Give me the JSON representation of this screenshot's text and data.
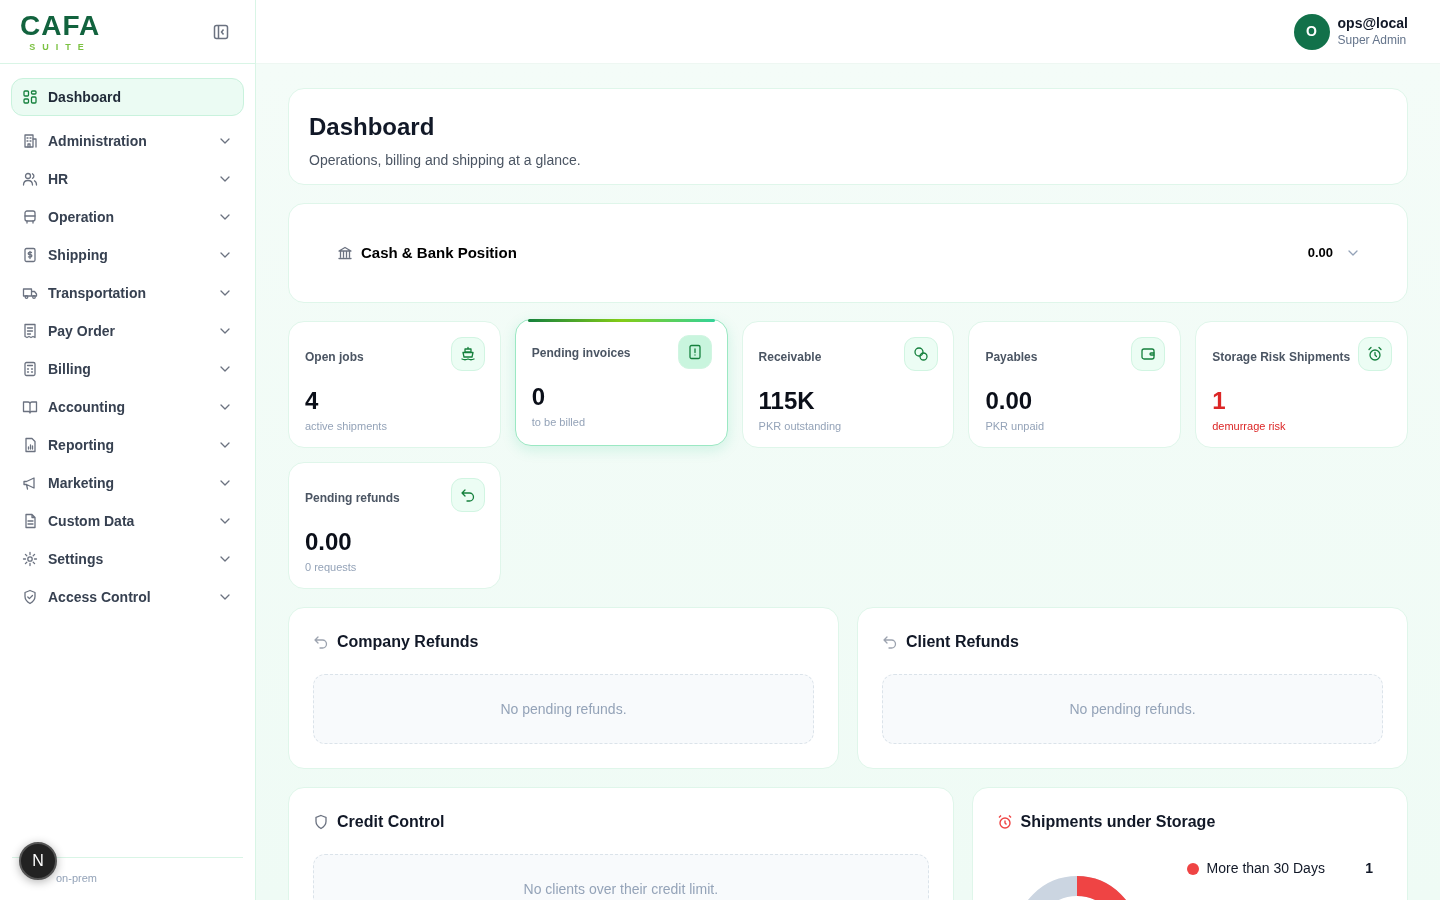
{
  "brand": {
    "logo_text": "CAFA",
    "logo_sub": "SUITE"
  },
  "user": {
    "initial": "O",
    "email": "ops@local",
    "role": "Super Admin"
  },
  "sidebar": {
    "items": [
      {
        "label": "Dashboard",
        "selected": true
      },
      {
        "label": "Administration",
        "selected": false,
        "expanded": false
      },
      {
        "label": "HR",
        "selected": false,
        "expanded": false
      },
      {
        "label": "Operation",
        "selected": false,
        "expanded": false
      },
      {
        "label": "Shipping",
        "selected": false,
        "expanded": false
      },
      {
        "label": "Transportation",
        "selected": false,
        "expanded": false
      },
      {
        "label": "Pay Order",
        "selected": false,
        "expanded": false
      },
      {
        "label": "Billing",
        "selected": false,
        "expanded": false
      },
      {
        "label": "Accounting",
        "selected": false,
        "expanded": false
      },
      {
        "label": "Reporting",
        "selected": false,
        "expanded": false
      },
      {
        "label": "Marketing",
        "selected": false,
        "expanded": false
      },
      {
        "label": "Custom Data",
        "selected": false,
        "expanded": false
      },
      {
        "label": "Settings",
        "selected": false,
        "expanded": false
      },
      {
        "label": "Access Control",
        "selected": false,
        "expanded": false
      }
    ],
    "footer": "on-prem",
    "dev_badge": "N"
  },
  "page": {
    "title": "Dashboard",
    "subtitle": "Operations, billing and shipping at a glance."
  },
  "cash_bank": {
    "title": "Cash & Bank Position",
    "amount": "0.00",
    "expanded": false
  },
  "stats": [
    {
      "label": "Open jobs",
      "value": "4",
      "note": "active shipments",
      "alert": false,
      "selected": false
    },
    {
      "label": "Pending invoices",
      "value": "0",
      "note": "to be billed",
      "alert": false,
      "selected": true
    },
    {
      "label": "Receivable",
      "value": "115K",
      "note": "PKR outstanding",
      "alert": false,
      "selected": false
    },
    {
      "label": "Payables",
      "value": "0.00",
      "note": "PKR unpaid",
      "alert": false,
      "selected": false
    },
    {
      "label": "Storage Risk Shipments",
      "value": "1",
      "note": "demurrage risk",
      "alert": true,
      "selected": false
    },
    {
      "label": "Pending refunds",
      "value": "0.00",
      "note": "0 requests",
      "alert": false,
      "selected": false
    }
  ],
  "refunds": [
    {
      "title": "Company Refunds",
      "empty": "No pending refunds."
    },
    {
      "title": "Client Refunds",
      "empty": "No pending refunds."
    }
  ],
  "credit_control": {
    "title": "Credit Control",
    "empty": "No clients over their credit limit."
  },
  "storage": {
    "title": "Shipments under Storage",
    "legend": [
      {
        "label": "More than 30 Days",
        "count": "1",
        "color": "#ef4444"
      }
    ]
  }
}
